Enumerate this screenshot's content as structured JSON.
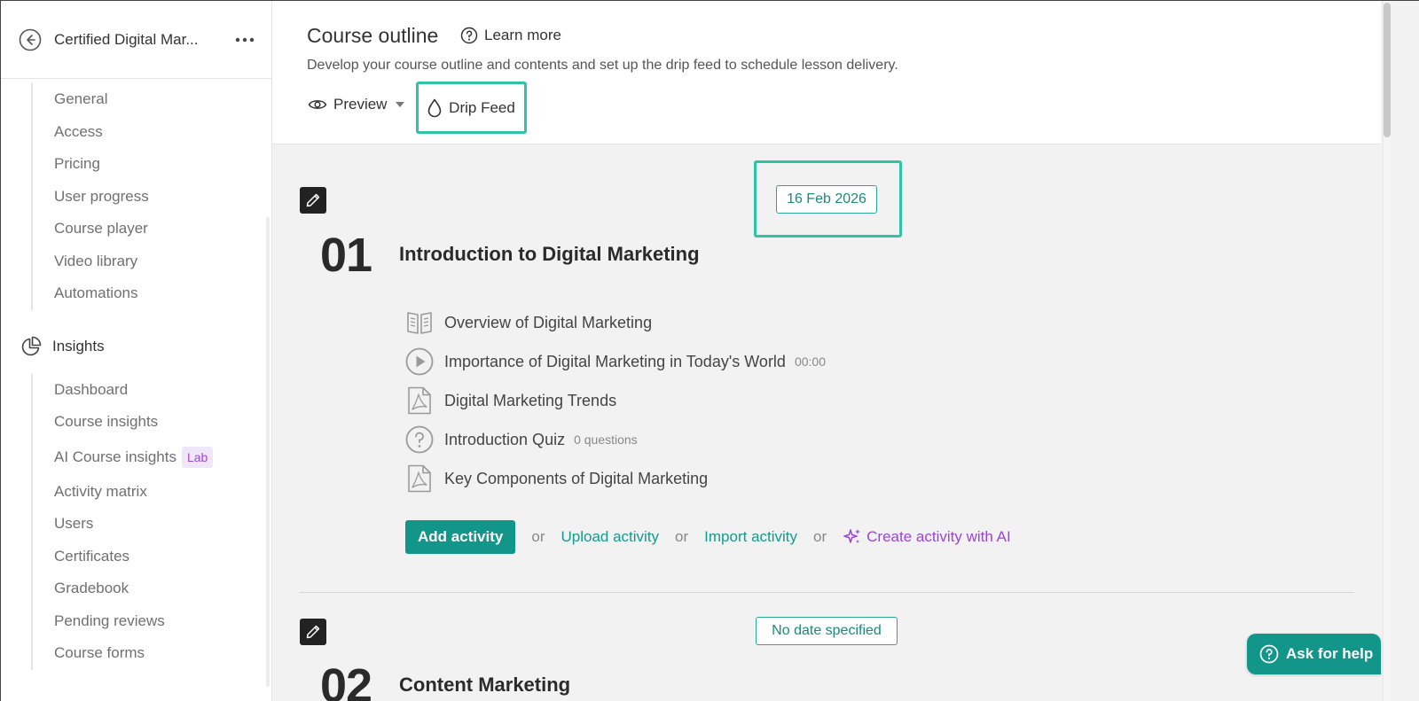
{
  "sidebar": {
    "course_title": "Certified Digital Mar...",
    "group1": [
      {
        "label": "General"
      },
      {
        "label": "Access"
      },
      {
        "label": "Pricing"
      },
      {
        "label": "User progress"
      },
      {
        "label": "Course player"
      },
      {
        "label": "Video library"
      },
      {
        "label": "Automations"
      }
    ],
    "insights_label": "Insights",
    "group2": [
      {
        "label": "Dashboard"
      },
      {
        "label": "Course insights"
      },
      {
        "label": "AI Course insights",
        "badge": "Lab"
      },
      {
        "label": "Activity matrix"
      },
      {
        "label": "Users"
      },
      {
        "label": "Certificates"
      },
      {
        "label": "Gradebook"
      },
      {
        "label": "Pending reviews"
      },
      {
        "label": "Course forms"
      }
    ]
  },
  "header": {
    "title": "Course outline",
    "learn_more": "Learn more",
    "description": "Develop your course outline and contents and set up the drip feed to schedule lesson delivery.",
    "preview_label": "Preview",
    "drip_feed_label": "Drip Feed"
  },
  "sections": [
    {
      "number": "01",
      "title": "Introduction to Digital Marketing",
      "date": "16 Feb 2026",
      "activities": [
        {
          "icon": "book-icon",
          "name": "Overview of Digital Marketing",
          "meta": ""
        },
        {
          "icon": "play-icon",
          "name": "Importance of Digital Marketing in Today's World",
          "meta": "00:00"
        },
        {
          "icon": "pdf-icon",
          "name": "Digital Marketing Trends",
          "meta": ""
        },
        {
          "icon": "quiz-icon",
          "name": "Introduction Quiz",
          "meta": "0 questions"
        },
        {
          "icon": "pdf-icon",
          "name": "Key Components of Digital Marketing",
          "meta": ""
        }
      ]
    },
    {
      "number": "02",
      "title": "Content Marketing",
      "date": "No date specified"
    }
  ],
  "actions": {
    "add_activity": "Add activity",
    "or": "or",
    "upload_activity": "Upload activity",
    "import_activity": "Import activity",
    "create_ai": "Create activity with AI"
  },
  "help": {
    "label": "Ask for help"
  },
  "colors": {
    "accent": "#12968a",
    "highlight": "#2ec4a6",
    "ai": "#9b45d8"
  }
}
